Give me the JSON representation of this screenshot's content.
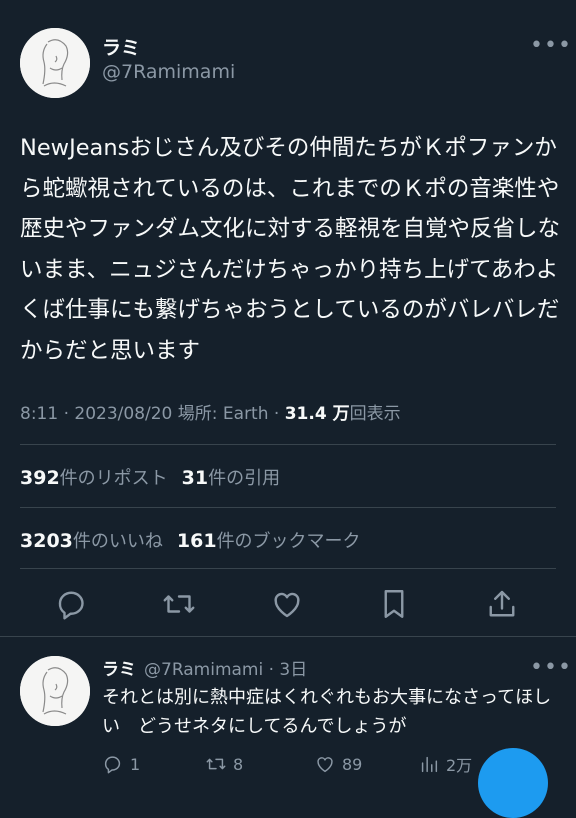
{
  "tweet": {
    "display_name": "ラミ",
    "handle": "@7Ramimami",
    "more_glyph": "•••",
    "text": "NewJeansおじさん及びその仲間たちがＫポファンから蛇蠍視されているのは、これまでのＫポの音楽性や歴史やファンダム文化に対する軽視を自覚や反省しないまま、ニュジさんだけちゃっかり持ち上げてあわよくば仕事にも繋げちゃおうとしているのがバレバレだからだと思います",
    "meta_prefix": "8:11 · 2023/08/20 場所: Earth · ",
    "views_value": "31.4 万",
    "views_label": "回表示",
    "reposts_value": "392",
    "reposts_label": "件のリポスト",
    "quotes_value": "31",
    "quotes_label": "件の引用",
    "likes_value": "3203",
    "likes_label": "件のいいね",
    "bookmarks_value": "161",
    "bookmarks_label": "件のブックマーク",
    "actions": [
      "reply-icon",
      "retweet-icon",
      "like-icon",
      "bookmark-icon",
      "share-icon"
    ]
  },
  "reply": {
    "display_name": "ラミ",
    "handle_time": "@7Ramimami · 3日",
    "more_glyph": "•••",
    "text": "それとは別に熱中症はくれぐれもお大事になさってほしい　どうせネタにしてるんでしょうが",
    "reply_count": "1",
    "retweet_count": "8",
    "like_count": "89",
    "view_count": "2万"
  },
  "colors": {
    "background": "#15202b",
    "text_primary": "#f7f9f9",
    "text_secondary": "#8b98a5",
    "divider": "#38444d",
    "accent": "#1d9bf0"
  }
}
